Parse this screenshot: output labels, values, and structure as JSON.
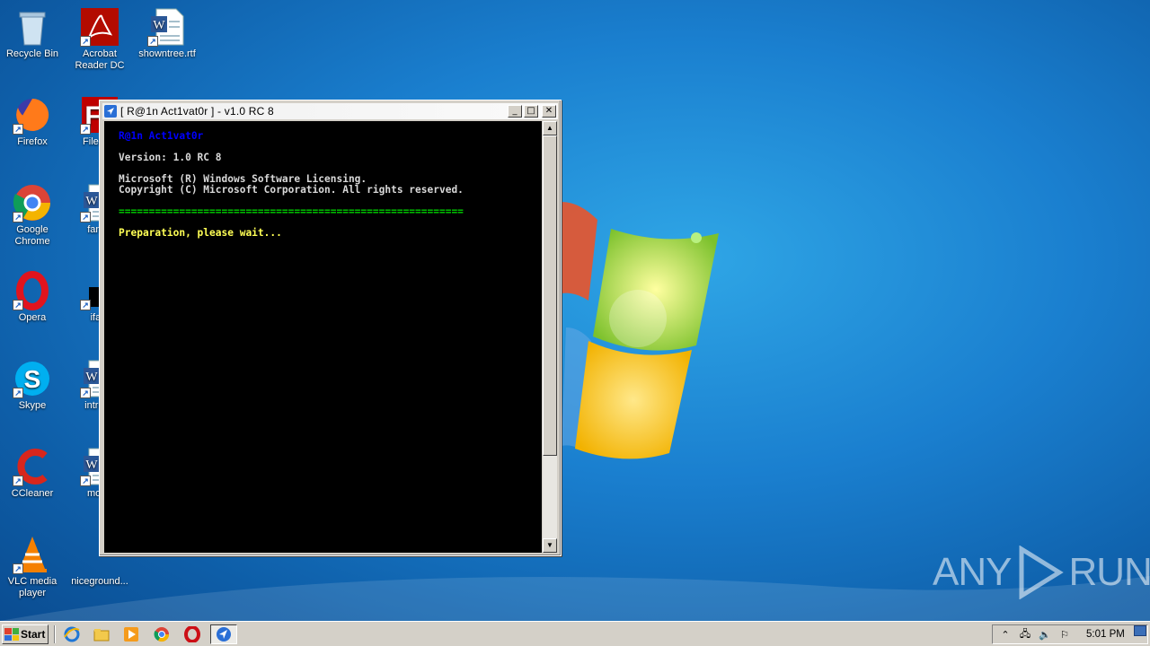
{
  "desktop": {
    "icons": [
      {
        "label": "Recycle Bin",
        "icon": "recycle-bin-icon"
      },
      {
        "label": "Acrobat Reader DC",
        "icon": "acrobat-icon"
      },
      {
        "label": "showntree.rtf",
        "icon": "word-doc-icon"
      },
      {
        "label": "Firefox",
        "icon": "firefox-icon"
      },
      {
        "label": "FileZilla",
        "icon": "filezilla-icon"
      },
      {
        "label": "Google Chrome",
        "icon": "chrome-icon"
      },
      {
        "label": "fanba",
        "icon": "word-doc-icon"
      },
      {
        "label": "Opera",
        "icon": "opera-icon"
      },
      {
        "label": "ifaut",
        "icon": "black-file-icon"
      },
      {
        "label": "Skype",
        "icon": "skype-icon"
      },
      {
        "label": "introdu",
        "icon": "word-doc-icon"
      },
      {
        "label": "CCleaner",
        "icon": "ccleaner-icon"
      },
      {
        "label": "motor",
        "icon": "word-doc-icon"
      },
      {
        "label": "VLC media player",
        "icon": "vlc-icon"
      },
      {
        "label": "niceground...",
        "icon": "blank-file-icon"
      }
    ]
  },
  "console": {
    "title": "[ R@1n Act1vat0r ] - v1.0 RC 8",
    "lines": [
      {
        "text": "R@1n Act1vat0r",
        "color": "#0000ff"
      },
      {
        "text": "",
        "color": "#d8d8d8"
      },
      {
        "text": "Version: 1.0 RC 8",
        "color": "#d8d8d8"
      },
      {
        "text": "",
        "color": "#d8d8d8"
      },
      {
        "text": "Microsoft (R) Windows Software Licensing.",
        "color": "#d8d8d8"
      },
      {
        "text": "Copyright (C) Microsoft Corporation. All rights reserved.",
        "color": "#d8d8d8"
      },
      {
        "text": "",
        "color": "#d8d8d8"
      },
      {
        "text": "=========================================================",
        "color": "#00d000"
      },
      {
        "text": "",
        "color": "#d8d8d8"
      },
      {
        "text": "Preparation, please wait...",
        "color": "#ffff55"
      }
    ],
    "buttons": {
      "minimize": "_",
      "maximize": "□",
      "close": "✕"
    }
  },
  "watermark": {
    "left": "ANY",
    "right": "RUN"
  },
  "taskbar": {
    "start_label": "Start",
    "quick_launch": [
      "ie-icon",
      "explorer-icon",
      "media-player-icon",
      "chrome-icon",
      "opera-icon"
    ],
    "active_task": "console-app-icon",
    "clock": "5:01 PM"
  }
}
